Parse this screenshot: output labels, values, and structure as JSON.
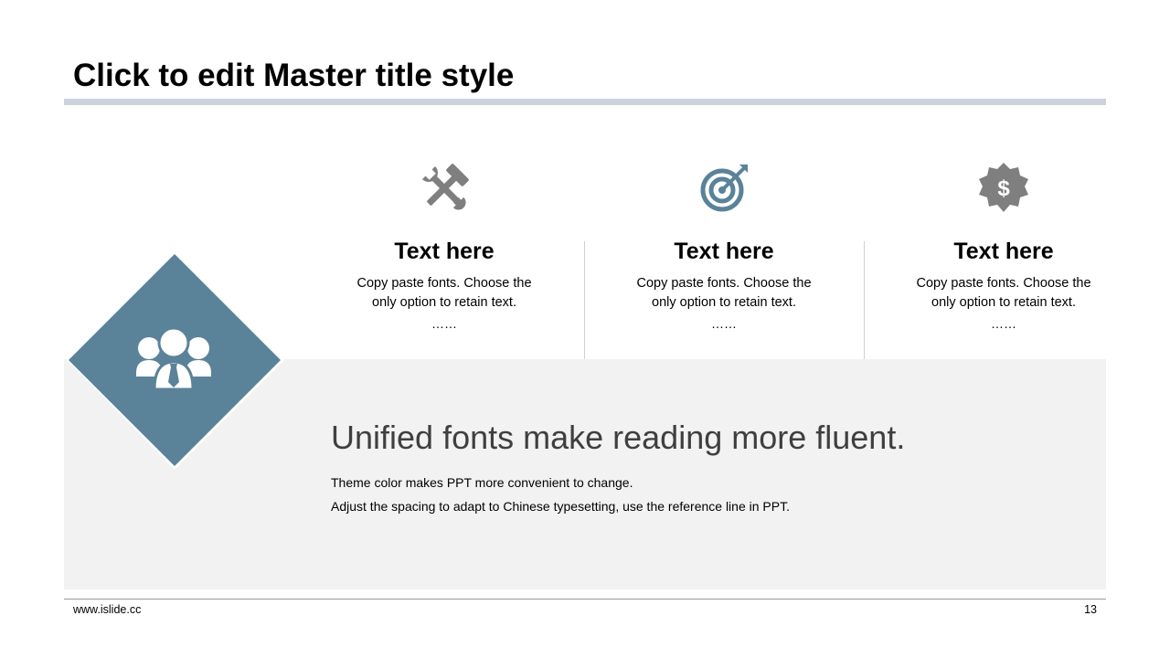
{
  "slide": {
    "title": "Click to edit Master title style",
    "colors": {
      "accent": "#5a8299",
      "icon_gray": "#7f7f7f",
      "title_bar": "#ccd2dc",
      "panel_bg": "#f2f2f2",
      "headline_text": "#3f3f3f"
    }
  },
  "features": [
    {
      "icon": "tools-icon",
      "title": "Text here",
      "desc_line1": "Copy paste fonts. Choose the",
      "desc_line2": "only option to retain text.",
      "ellipsis": "……"
    },
    {
      "icon": "target-icon",
      "title": "Text here",
      "desc_line1": "Copy paste fonts. Choose the",
      "desc_line2": "only option to retain text.",
      "ellipsis": "……"
    },
    {
      "icon": "dollar-badge-icon",
      "title": "Text here",
      "desc_line1": "Copy paste fonts. Choose the",
      "desc_line2": "only option to retain text.",
      "ellipsis": "……"
    }
  ],
  "team_icon": "team-icon",
  "main": {
    "headline": "Unified fonts make reading more fluent.",
    "line1": "Theme color makes PPT more convenient to change.",
    "line2": "Adjust the spacing to adapt to Chinese typesetting, use the reference line in PPT."
  },
  "footer": {
    "website": "www.islide.cc",
    "page_number": "13"
  }
}
